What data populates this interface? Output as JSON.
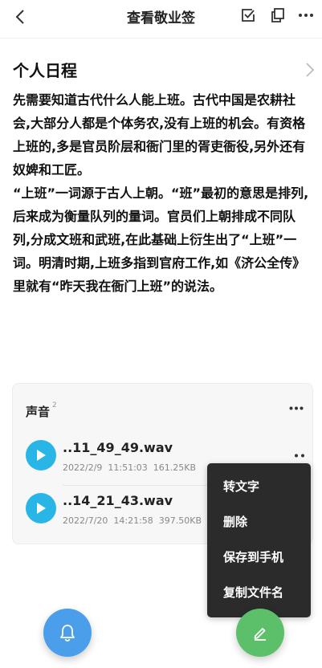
{
  "header": {
    "title": "查看敬业签"
  },
  "note": {
    "heading": "个人日程",
    "paragraphs": [
      "先需要知道古代什么人能上班。古代中国是农耕社会,大部分人都是个体务农,没有上班的机会。有资格上班的,多是官员阶层和衙门里的胥吏衙役,另外还有奴婢和工匠。",
      "“上班”一词源于古人上朝。“班”最初的意思是排列,后来成为衡量队列的量词。官员们上朝排成不同队列,分成文班和武班,在此基础上衍生出了“上班”一词。明清时期,上班多指到官府工作,如《济公全传》里就有“昨天我在衙门上班”的说法。"
    ]
  },
  "audio": {
    "title": "声音",
    "count": "2",
    "items": [
      {
        "filename": "..11_49_49.wav",
        "meta": "2022/2/9  11:51:03  161.25KB"
      },
      {
        "filename": "..14_21_43.wav",
        "meta": "2022/7/20  14:21:58  397.50KB"
      }
    ]
  },
  "context_menu": {
    "items": [
      "转文字",
      "删除",
      "保存到手机",
      "复制文件名"
    ]
  },
  "colors": {
    "play_button": "#29b6e6",
    "bell_fab": "#4b9fea",
    "edit_fab": "#5cbf6a",
    "menu_bg": "#2b2b2b"
  },
  "icons": {
    "back": "chevron-left-icon",
    "check": "checkbox-icon",
    "copy": "copy-icon",
    "more": "more-horizontal-icon",
    "play": "play-icon",
    "bell": "bell-icon",
    "edit": "pencil-icon",
    "expand": "chevron-right-icon"
  }
}
